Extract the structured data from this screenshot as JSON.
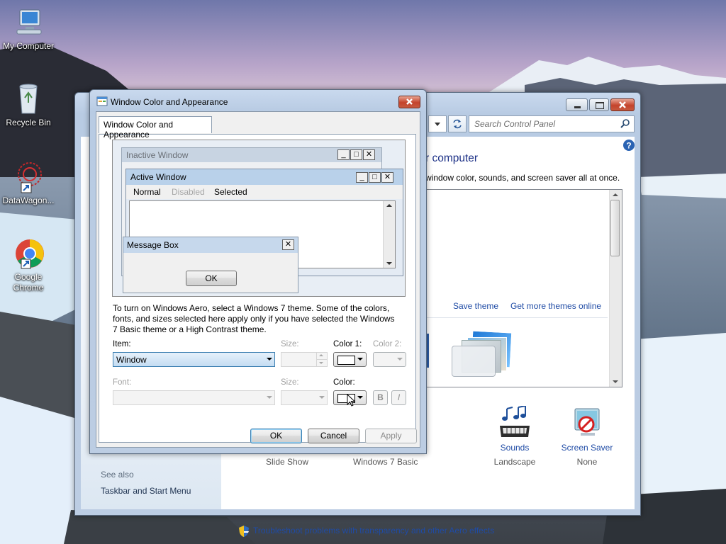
{
  "desktop": {
    "icons": [
      {
        "label": "My Computer",
        "icon": "computer-icon"
      },
      {
        "label": "Recycle Bin",
        "icon": "recycle-bin-icon"
      },
      {
        "label": "DataWagon...",
        "icon": "datawagon-icon"
      },
      {
        "label": "Google\nChrome",
        "icon": "chrome-icon"
      }
    ]
  },
  "control_panel": {
    "search_placeholder": "Search Control Panel",
    "heading_fragment": "r computer",
    "subheading_fragment": "window color, sounds, and screen saver all at once.",
    "links": {
      "save_theme": "Save theme",
      "get_more": "Get more themes online"
    },
    "items": [
      {
        "label": "Sounds",
        "sub": "Landscape",
        "icon": "music-notes-icon"
      },
      {
        "label": "Screen Saver",
        "sub": "None",
        "icon": "screen-saver-icon"
      }
    ],
    "partial_labels": {
      "slide_show": "Slide Show",
      "win7_basic": "Windows 7 Basic"
    },
    "see_also": {
      "title": "See also",
      "items": [
        "Taskbar and Start Menu"
      ]
    },
    "troubleshoot": "Troubleshoot problems with transparency and other Aero effects"
  },
  "dialog": {
    "title": "Window Color and Appearance",
    "tab": "Window Color and Appearance",
    "preview": {
      "inactive_title": "Inactive Window",
      "active_title": "Active Window",
      "menu": {
        "normal": "Normal",
        "disabled": "Disabled",
        "selected": "Selected"
      },
      "msgbox_title": "Message Box",
      "msgbox_ok": "OK"
    },
    "info_text": "To turn on Windows Aero, select a Windows 7 theme.  Some of the colors, fonts, and sizes selected here apply only if you have selected the Windows 7 Basic theme or a High Contrast theme.",
    "labels": {
      "item": "Item:",
      "size": "Size:",
      "color1": "Color 1:",
      "color2": "Color 2:",
      "font": "Font:",
      "size2": "Size:",
      "color": "Color:",
      "bold": "B",
      "italic": "I"
    },
    "item_value": "Window",
    "buttons": {
      "ok": "OK",
      "cancel": "Cancel",
      "apply": "Apply"
    }
  }
}
